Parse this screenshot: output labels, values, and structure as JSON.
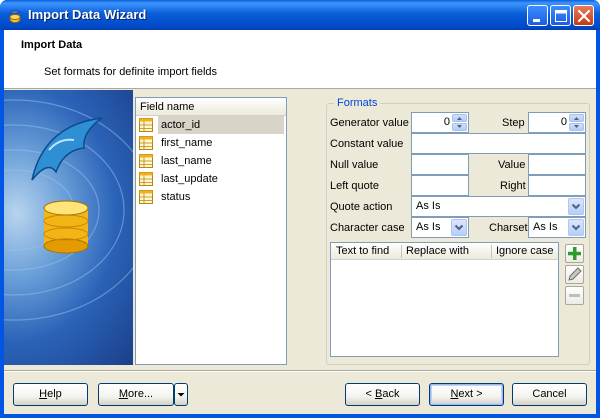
{
  "window": {
    "title": "Import Data Wizard"
  },
  "header": {
    "title": "Import Data",
    "subtitle": "Set formats for definite import fields"
  },
  "field_list": {
    "header": "Field name",
    "items": [
      "actor_id",
      "first_name",
      "last_name",
      "last_update",
      "status"
    ],
    "selected_index": 0
  },
  "formats": {
    "legend": "Formats",
    "generator_value_label": "Generator value",
    "generator_value": "0",
    "step_label": "Step",
    "step_value": "0",
    "constant_value_label": "Constant value",
    "constant_value": "",
    "null_value_label": "Null value",
    "null_value": "",
    "value_label": "Value",
    "value_value": "",
    "left_quote_label": "Left quote",
    "left_quote": "",
    "right_label": "Right",
    "right_quote": "",
    "quote_action_label": "Quote action",
    "quote_action": "As Is",
    "character_case_label": "Character case",
    "character_case": "As Is",
    "charset_label": "Charset",
    "charset": "As Is",
    "replace_table": {
      "columns": [
        "Text to find",
        "Replace with",
        "Ignore case"
      ],
      "rows": []
    }
  },
  "buttons": {
    "help": {
      "prefix": "",
      "accel": "H",
      "rest": "elp"
    },
    "more": {
      "prefix": "",
      "accel": "M",
      "rest": "ore..."
    },
    "back": {
      "prefix": "< ",
      "accel": "B",
      "rest": "ack"
    },
    "next": {
      "prefix": "",
      "accel": "N",
      "rest": "ext >"
    },
    "cancel": {
      "prefix": "",
      "accel": "",
      "rest": "Cancel"
    }
  },
  "colors": {
    "titlebar": "#0a5fd8",
    "client_bg": "#ece9d8",
    "legend_text": "#0046d5",
    "selected_row": "#d8d4c8"
  },
  "icons": {
    "app": "dolphin-db-icon",
    "field": "table-field-icon",
    "add": "plus-icon",
    "edit": "pencil-icon",
    "remove": "minus-icon"
  }
}
